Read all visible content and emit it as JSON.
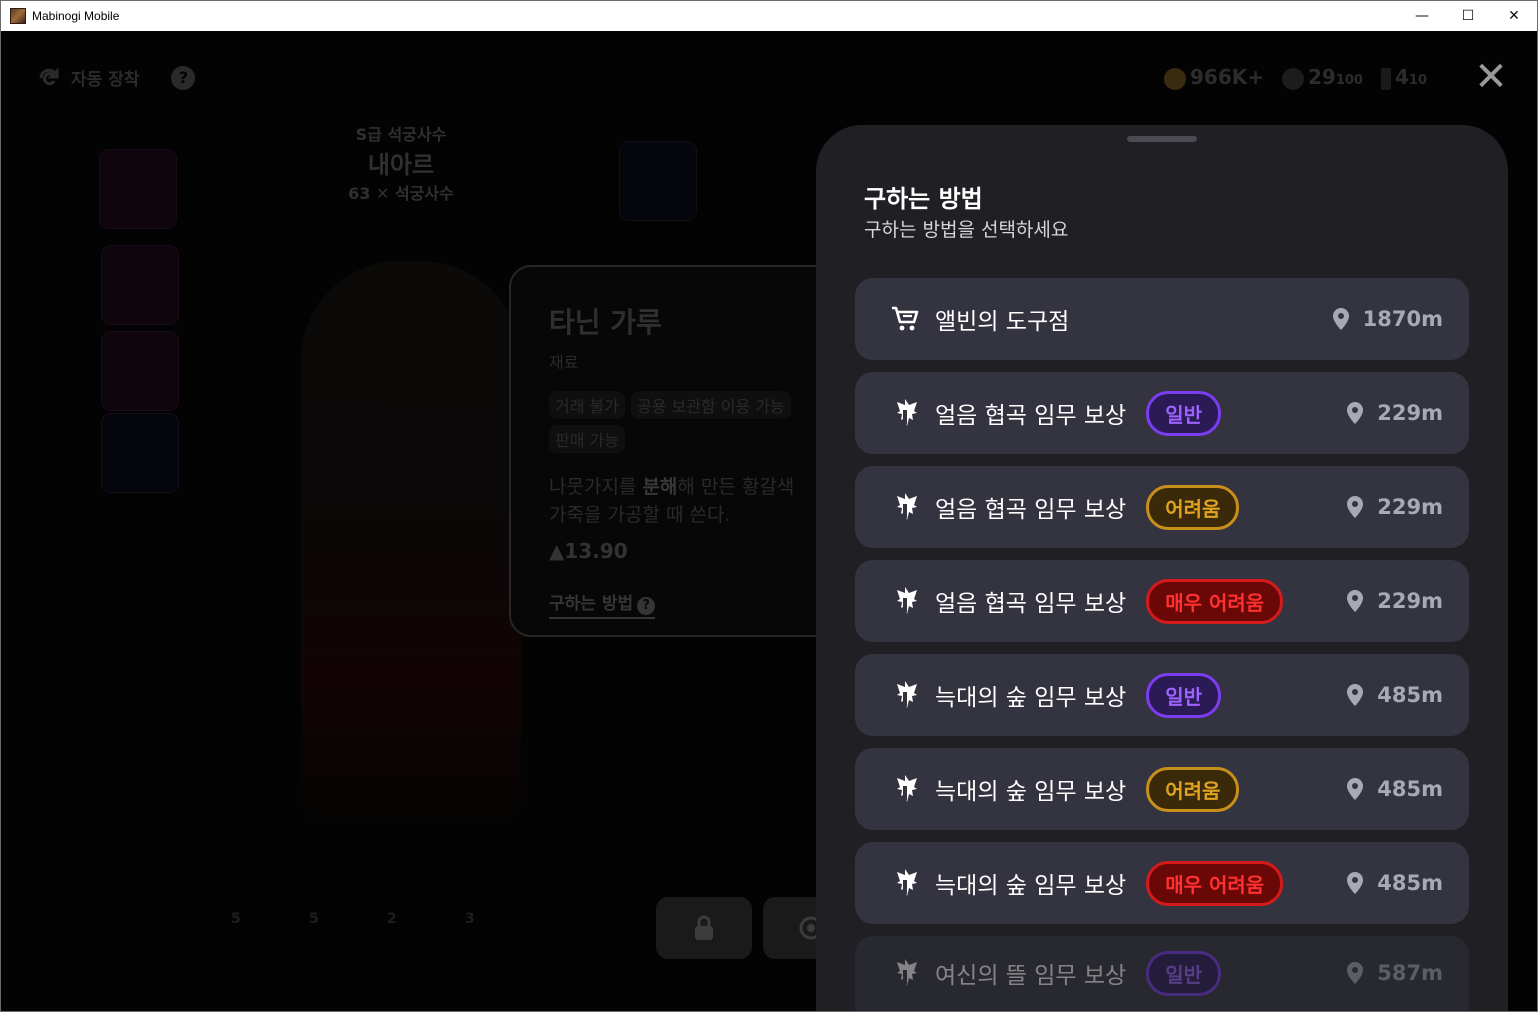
{
  "window": {
    "title": "Mabinogi Mobile",
    "minimize_glyph": "—",
    "maximize_glyph": "☐",
    "close_glyph": "✕"
  },
  "background": {
    "auto_equip_label": "자동 장착",
    "help_glyph": "?",
    "currency": [
      {
        "value": "966K+",
        "icon": "gold-coin-icon"
      },
      {
        "value": "29",
        "max": "100",
        "icon": "gem-icon"
      },
      {
        "value": "4",
        "max": "10",
        "icon": "stamina-icon"
      }
    ],
    "close_glyph": "✕",
    "character": {
      "grade": "S급 석궁사수",
      "name": "내아르",
      "level": "63",
      "class": "석궁사수"
    },
    "item_card": {
      "name": "타닌 가루",
      "type": "재료",
      "tags": [
        "거래 불가",
        "공용 보관함 이용 가능",
        "판매 가능"
      ],
      "desc_part1": "나뭇가지를 ",
      "desc_bold": "분해",
      "desc_part2": "해 만든 황갈색 가죽을 가공할 때 쓴다.",
      "weight": "13.90",
      "how_to_link": "구하는 방법",
      "how_to_glyph": "?"
    },
    "bottom_slot_counts": [
      "5",
      "5",
      "2",
      "3"
    ]
  },
  "panel": {
    "title": "구하는 방법",
    "subtitle": "구하는 방법을 선택하세요",
    "rows": [
      {
        "icon": "shop-cart-icon",
        "label": "앨빈의 도구점",
        "badge": "",
        "badge_type": "",
        "distance": "1870m"
      },
      {
        "icon": "quest-crest-icon",
        "label": "얼음 협곡 임무 보상",
        "badge": "일반",
        "badge_type": "normal",
        "distance": "229m"
      },
      {
        "icon": "quest-crest-icon",
        "label": "얼음 협곡 임무 보상",
        "badge": "어려움",
        "badge_type": "hard",
        "distance": "229m"
      },
      {
        "icon": "quest-crest-icon",
        "label": "얼음 협곡 임무 보상",
        "badge": "매우 어려움",
        "badge_type": "veryhard",
        "distance": "229m"
      },
      {
        "icon": "quest-crest-icon",
        "label": "늑대의 숲 임무 보상",
        "badge": "일반",
        "badge_type": "normal",
        "distance": "485m"
      },
      {
        "icon": "quest-crest-icon",
        "label": "늑대의 숲 임무 보상",
        "badge": "어려움",
        "badge_type": "hard",
        "distance": "485m"
      },
      {
        "icon": "quest-crest-icon",
        "label": "늑대의 숲 임무 보상",
        "badge": "매우 어려움",
        "badge_type": "veryhard",
        "distance": "485m"
      },
      {
        "icon": "quest-crest-icon",
        "label": "여신의 뜰 임무 보상",
        "badge": "일반",
        "badge_type": "normal",
        "distance": "587m"
      }
    ]
  },
  "colors": {
    "panel_bg": "#1f1f24",
    "row_bg": "#343440",
    "badge_normal": "#7c3cf0",
    "badge_hard": "#c8901a",
    "badge_veryhard": "#d41a1a"
  }
}
